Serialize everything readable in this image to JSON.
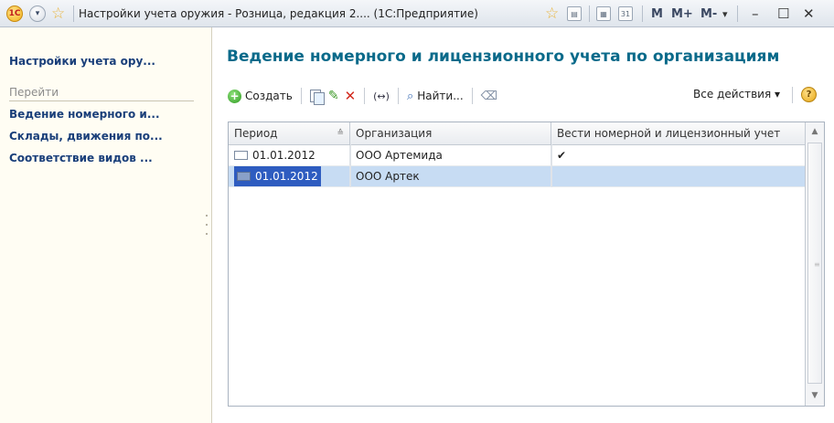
{
  "window": {
    "title": "Настройки учета оружия - Розница, редакция 2.... (1С:Предприятие)",
    "logo_text": "1С",
    "m_labels": [
      "M",
      "M+",
      "M-"
    ],
    "calendar_day": "31"
  },
  "left_panel": {
    "title": "Настройки учета ору...",
    "goto_label": "Перейти",
    "items": [
      {
        "label": "Ведение номерного и..."
      },
      {
        "label": "Склады, движения по..."
      },
      {
        "label": "Соответствие видов ..."
      }
    ]
  },
  "main": {
    "title": "Ведение номерного и лицензионного учета по организациям",
    "toolbar": {
      "create_label": "Создать",
      "find_label": "Найти...",
      "all_actions_label": "Все действия ▾",
      "move_label": "(↔)"
    },
    "table": {
      "columns": [
        "Период",
        "Организация",
        "Вести номерной и лицензионный учет"
      ],
      "rows": [
        {
          "period": "01.01.2012",
          "organization": "ООО Артемида",
          "keep": "✔",
          "selected": false
        },
        {
          "period": "01.01.2012",
          "organization": "ООО Артек",
          "keep": "",
          "selected": true
        }
      ]
    }
  },
  "colors": {
    "accent_title": "#0a6a8a",
    "nav_link": "#1a3f7a",
    "selection": "#c7dcf3"
  }
}
